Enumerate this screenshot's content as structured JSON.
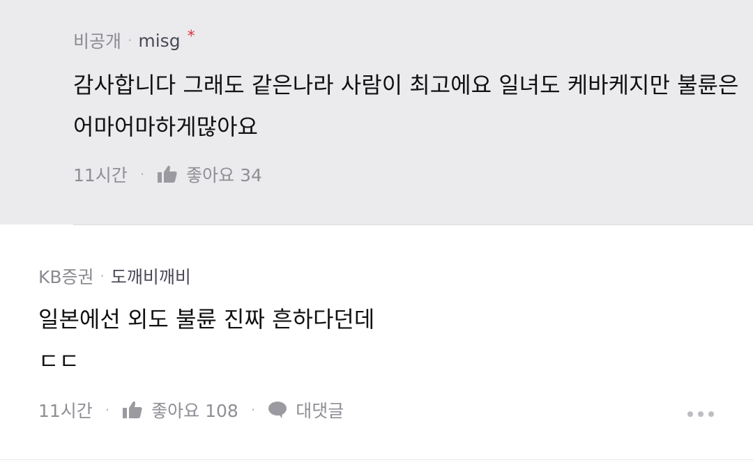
{
  "reply": {
    "company": "비공개",
    "nickname": "misg",
    "author_marker": "*",
    "text_line1": "감사합니다 그래도 같은나라 사람이 최고에요 일녀도 케바케지만 불륜은",
    "text_line2": "어마어마하게많아요",
    "time": "11시간",
    "like_label": "좋아요 34"
  },
  "comment": {
    "company": "KB증권",
    "nickname": "도깨비깨비",
    "text_line1": "일본에선 외도 불륜 진짜 흔하다던데",
    "text_line2": "ㄷㄷ",
    "time": "11시간",
    "like_label": "좋아요 108",
    "reply_label": "대댓글"
  },
  "icons": {
    "like": "thumbs-up-icon",
    "reply": "speech-bubble-icon",
    "more": "more-dots-icon"
  },
  "colors": {
    "reply_background": "#ebebee",
    "author_marker": "#e0303e",
    "meta_text": "#8e8e94"
  }
}
